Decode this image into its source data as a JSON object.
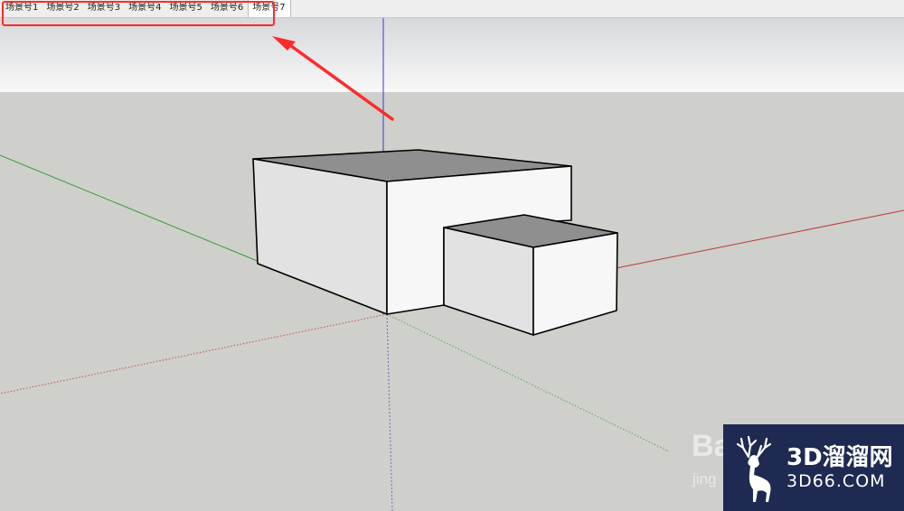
{
  "app": {
    "scene_tabs": [
      {
        "label": "场景号1",
        "active": false
      },
      {
        "label": "场景号2",
        "active": false
      },
      {
        "label": "场景号3",
        "active": false
      },
      {
        "label": "场景号4",
        "active": false
      },
      {
        "label": "场景号5",
        "active": false
      },
      {
        "label": "场景号6",
        "active": false
      },
      {
        "label": "场景号7",
        "active": true
      }
    ]
  },
  "annotation": {
    "highlight_color": "#ff2a2a",
    "arrow_color": "#ff2a2a"
  },
  "colors": {
    "sky_top": "#d9dbdc",
    "sky_bottom": "#f7f7f7",
    "ground": "#cfcfcb",
    "red_axis": "#b83a3a",
    "green_axis": "#3a9a3a",
    "blue_axis": "#3a3ad0",
    "face_light": "#f7f7f7",
    "face_shaded": "#e2e2e2",
    "roof": "#8f8f8f"
  },
  "watermark": {
    "partial_text_1": "Ba",
    "partial_text_2": "jing"
  },
  "logo": {
    "main_text": "3D溜溜网",
    "sub_text": "3D66.COM",
    "icon": "deer-icon",
    "background": "#1f2a52"
  }
}
